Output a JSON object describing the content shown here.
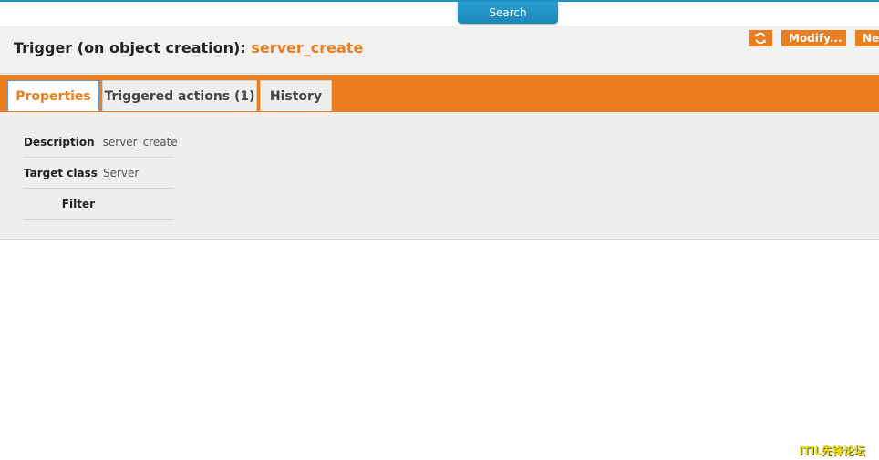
{
  "search_tab": {
    "label": "Search"
  },
  "header": {
    "title_prefix": "Trigger (on object creation):",
    "object_name": "server_create",
    "buttons": {
      "refresh_icon": "refresh-icon",
      "modify_label": "Modify...",
      "new_label": "Ne"
    }
  },
  "tabs": [
    {
      "label": "Properties",
      "active": true
    },
    {
      "label": "Triggered actions (1)",
      "active": false
    },
    {
      "label": "History",
      "active": false
    }
  ],
  "properties": [
    {
      "label": "Description",
      "value": "server_create"
    },
    {
      "label": "Target class",
      "value": "Server"
    },
    {
      "label": "Filter",
      "value": ""
    }
  ],
  "watermark": {
    "text": "ITIL先锋论坛"
  },
  "colors": {
    "accent": "#ea7d1e",
    "search_tab": "#1c94c4"
  }
}
